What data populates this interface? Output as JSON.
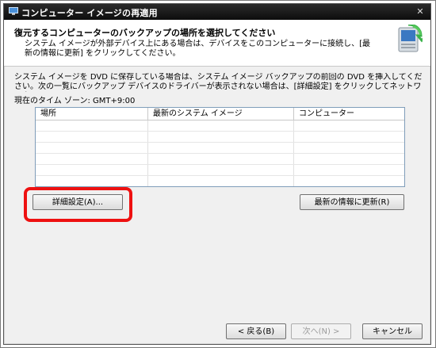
{
  "window": {
    "title": "コンピューター イメージの再適用",
    "close_glyph": "✕"
  },
  "header": {
    "title": "復元するコンピューターのバックアップの場所を選択してください",
    "description": "システム イメージが外部デバイス上にある場合は、デバイスをこのコンピューターに接続し、[最新の情報に更新] をクリックしてください。",
    "icon": "computer-restore-icon"
  },
  "body": {
    "instruction": "システム イメージを DVD に保存している場合は、システム イメージ バックアップの前回の DVD を挿入してください。次の一覧にバックアップ デバイスのドライバーが表示されない場合は、[詳細設定] をクリックしてネットワークの",
    "timezone": "現在のタイム ゾーン: GMT+9:00"
  },
  "table": {
    "columns": [
      "場所",
      "最新のシステム イメージ",
      "コンピューター"
    ],
    "rows": [
      [
        "",
        "",
        ""
      ],
      [
        "",
        "",
        ""
      ],
      [
        "",
        "",
        ""
      ],
      [
        "",
        "",
        ""
      ],
      [
        "",
        "",
        ""
      ],
      [
        "",
        "",
        ""
      ]
    ]
  },
  "buttons": {
    "advanced": "詳細設定(A)...",
    "refresh": "最新の情報に更新(R)",
    "back": "< 戻る(B)",
    "next": "次へ(N) >",
    "cancel": "キャンセル"
  },
  "colors": {
    "highlight": "#ee1111",
    "titlebar": "#0d0d0d"
  }
}
